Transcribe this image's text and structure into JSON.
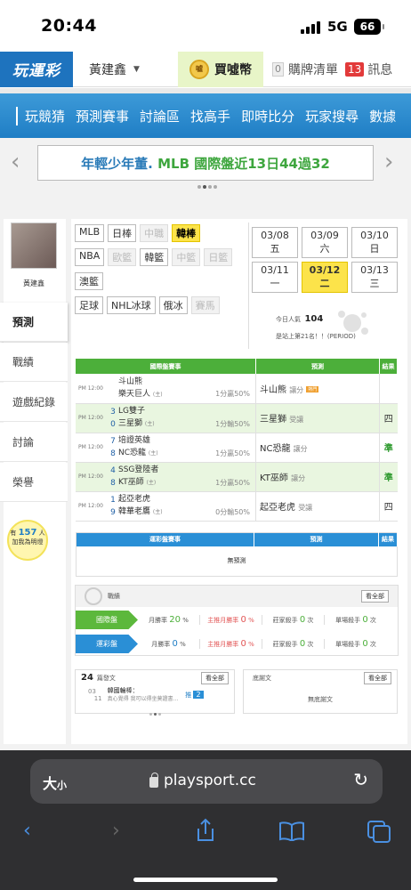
{
  "status_bar": {
    "time": "20:44",
    "network": "5G",
    "battery": "66"
  },
  "topbar": {
    "logo": "玩運彩",
    "username": "黃建鑫",
    "buy_coin": "買噓幣",
    "coin_icon_text": "噓",
    "cart_label": "購牌清單",
    "cart_count": "0",
    "messages_label": "訊息",
    "messages_count": "13"
  },
  "nav": [
    "玩競猜",
    "預測賽事",
    "討論區",
    "找高手",
    "即時比分",
    "玩家搜尋",
    "數據"
  ],
  "banner": {
    "text_blue": "年輕少年董.",
    "text_green": "MLB 國際盤近13日44過32"
  },
  "profile": {
    "name": "黃建鑫"
  },
  "side_menu": [
    "預測",
    "戰績",
    "遊戲紀錄",
    "討論",
    "榮譽"
  ],
  "helper": {
    "prefix": "有",
    "count": "157",
    "unit": "人",
    "text": "加我為明燈"
  },
  "sports": [
    [
      {
        "label": "MLB",
        "state": "normal"
      },
      {
        "label": "日棒",
        "state": "normal"
      },
      {
        "label": "中職",
        "state": "disabled"
      },
      {
        "label": "韓棒",
        "state": "selected"
      }
    ],
    [
      {
        "label": "NBA",
        "state": "normal"
      },
      {
        "label": "歐籃",
        "state": "disabled"
      },
      {
        "label": "韓籃",
        "state": "normal"
      },
      {
        "label": "中籃",
        "state": "disabled"
      },
      {
        "label": "日籃",
        "state": "disabled"
      }
    ],
    [
      {
        "label": "澳籃",
        "state": "normal"
      }
    ],
    [
      {
        "label": "足球",
        "state": "normal"
      },
      {
        "label": "NHL冰球",
        "state": "normal"
      },
      {
        "label": "俄冰",
        "state": "normal"
      },
      {
        "label": "賽馬",
        "state": "disabled"
      }
    ]
  ],
  "dates": [
    {
      "label": "03/08 五",
      "selected": false
    },
    {
      "label": "03/09 六",
      "selected": false
    },
    {
      "label": "03/10 日",
      "selected": false
    },
    {
      "label": "03/11 一",
      "selected": false
    },
    {
      "label": "03/12 二",
      "selected": true
    },
    {
      "label": "03/13 三",
      "selected": false
    }
  ],
  "popularity": {
    "label": "今日人氣",
    "value": "104",
    "rank": "是站上第21名！！(PERIOD)"
  },
  "games_table": {
    "headers": [
      "國際盤賽事",
      "預測",
      "結果"
    ],
    "rows": [
      {
        "time": "PM 12:00",
        "s1": "",
        "s2": "",
        "t1": "斗山熊",
        "t2": "樂天巨人",
        "h2": "(主)",
        "line": "1分贏50%",
        "pick": "斗山熊",
        "pick_type": "讓分",
        "hot": "熱門",
        "result": ""
      },
      {
        "time": "PM 12:00",
        "s1": "3",
        "s2": "0",
        "t1": "LG雙子",
        "t2": "三星獅",
        "h2": "(主)",
        "line": "1分輸50%",
        "pick": "三星獅",
        "pick_type": "受讓",
        "hot": "",
        "result": "四"
      },
      {
        "time": "PM 12:00",
        "s1": "7",
        "s2": "8",
        "t1": "培證英雄",
        "t2": "NC恐龍",
        "h2": "(主)",
        "line": "1分贏50%",
        "pick": "NC恐龍",
        "pick_type": "讓分",
        "hot": "",
        "result": "準"
      },
      {
        "time": "PM 12:00",
        "s1": "4",
        "s2": "8",
        "t1": "SSG登陸者",
        "t2": "KT巫師",
        "h2": "(主)",
        "line": "1分贏50%",
        "pick": "KT巫師",
        "pick_type": "讓分",
        "hot": "",
        "result": "準"
      },
      {
        "time": "PM 12:00",
        "s1": "1",
        "s2": "9",
        "t1": "起亞老虎",
        "t2": "韓華老鷹",
        "h2": "(主)",
        "line": "0分輸50%",
        "pick": "起亞老虎",
        "pick_type": "受讓",
        "hot": "",
        "result": "四"
      }
    ]
  },
  "lottery_table": {
    "headers": [
      "運彩盤賽事",
      "預測",
      "結果"
    ],
    "empty": "無預測"
  },
  "record": {
    "title": "戰績",
    "more": "看全部",
    "rows": [
      {
        "label": "國際盤",
        "color": "#5cb83c",
        "win_label": "月勝率",
        "win": "20",
        "main_label": "主推月勝率",
        "main": "0",
        "kill_label": "莊家殺手",
        "kill": "0",
        "single_label": "單場殺手",
        "single": "0",
        "unit_pct": "%",
        "unit_cnt": "次"
      },
      {
        "label": "運彩盤",
        "color": "#2a8fd6",
        "win_label": "月勝率",
        "win": "0",
        "main_label": "主推月勝率",
        "main": "0",
        "kill_label": "莊家殺手",
        "kill": "0",
        "single_label": "單場殺手",
        "single": "0",
        "unit_pct": "%",
        "unit_cnt": "次"
      }
    ]
  },
  "articles": {
    "count": "24",
    "label": "篇發文",
    "more": "看全部",
    "date_m": "03",
    "date_d": "11",
    "title": "韓國輪棒：",
    "sub": "真心覺得 我可以得坐莫證書...",
    "push_label": "推",
    "push": "2"
  },
  "replies": {
    "label": "底謝文",
    "more": "看全部",
    "empty": "無底謝文"
  },
  "safari": {
    "aa": "大",
    "aa_small": "小",
    "url": "playsport.cc"
  }
}
